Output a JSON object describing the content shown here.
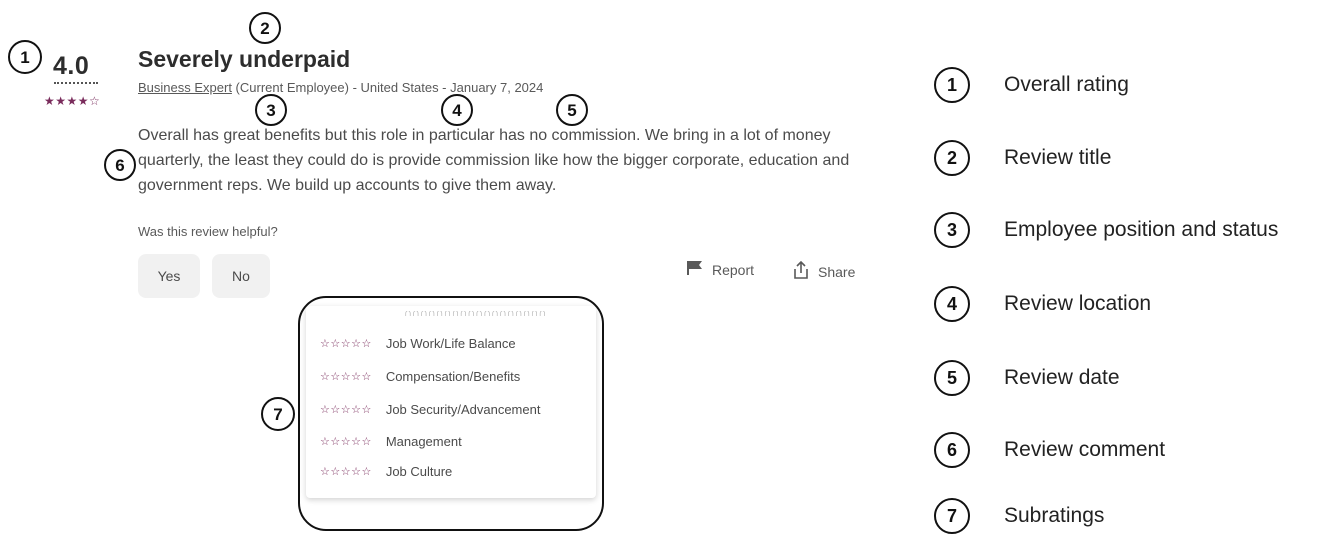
{
  "review": {
    "rating": "4.0",
    "rating_stars": "★★★★☆",
    "title": "Severely underpaid",
    "position": "Business Expert",
    "meta_rest": " (Current Employee) - United States - January 7, 2024",
    "comment": "Overall has great benefits but this role in particular has no commission. We bring in a lot of money quarterly, the least they could do is provide commission like how the bigger corporate, education and government reps. We build up accounts to give them away.",
    "helpful_question": "Was this review helpful?",
    "yes_label": "Yes",
    "no_label": "No",
    "report_label": "Report",
    "share_label": "Share",
    "accent_color": "#7a2c5c"
  },
  "subratings": {
    "stars": "☆☆☆☆☆",
    "items": [
      {
        "label": "Job Work/Life Balance"
      },
      {
        "label": "Compensation/Benefits"
      },
      {
        "label": "Job Security/Advancement"
      },
      {
        "label": "Management"
      },
      {
        "label": "Job Culture"
      }
    ]
  },
  "markers": [
    "1",
    "2",
    "3",
    "4",
    "5",
    "6",
    "7"
  ],
  "legend": [
    {
      "num": "1",
      "label": "Overall rating"
    },
    {
      "num": "2",
      "label": "Review title"
    },
    {
      "num": "3",
      "label": "Employee position and status"
    },
    {
      "num": "4",
      "label": "Review location"
    },
    {
      "num": "5",
      "label": "Review date"
    },
    {
      "num": "6",
      "label": "Review comment"
    },
    {
      "num": "7",
      "label": "Subratings"
    }
  ]
}
